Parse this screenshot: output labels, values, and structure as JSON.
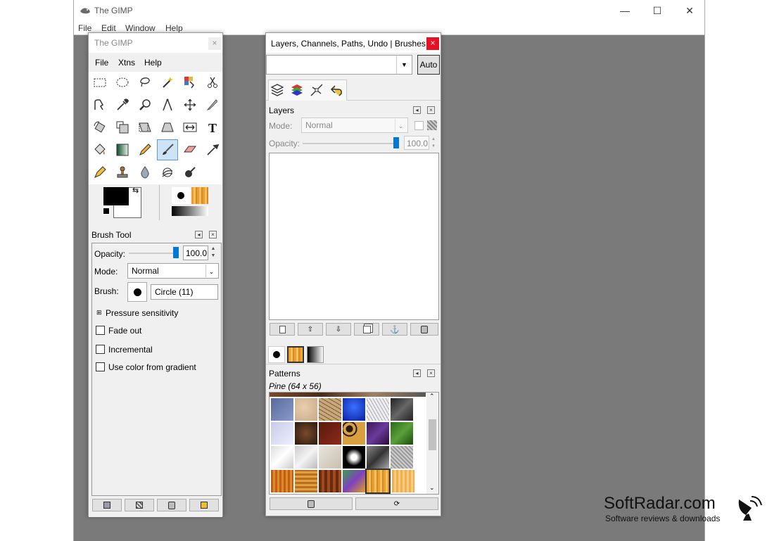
{
  "main_window": {
    "title": "The GIMP",
    "menu": [
      "File",
      "Edit",
      "Window",
      "Help"
    ],
    "minimize": "—",
    "maximize": "☐",
    "close": "✕"
  },
  "toolbox": {
    "title": "The GIMP",
    "close": "×",
    "menu": [
      "File",
      "Xtns",
      "Help"
    ],
    "tool_options": {
      "title": "Brush Tool",
      "opacity_label": "Opacity:",
      "opacity_value": "100.0",
      "opacity_fraction": 1.0,
      "mode_label": "Mode:",
      "mode_value": "Normal",
      "brush_label": "Brush:",
      "brush_value": "Circle (11)",
      "pressure_label": "Pressure sensitivity",
      "fade_out_label": "Fade out",
      "incremental_label": "Incremental",
      "use_color_label": "Use color from gradient"
    }
  },
  "layers_dock": {
    "title": "Layers, Channels, Paths, Undo | Brushes,...",
    "close": "×",
    "auto_label": "Auto",
    "layers": {
      "title": "Layers",
      "mode_label": "Mode:",
      "mode_value": "Normal",
      "opacity_label": "Opacity:",
      "opacity_value": "100.0",
      "opacity_fraction": 1.0
    },
    "patterns": {
      "title": "Patterns",
      "selected_label": "Pine (64 x 56)"
    }
  },
  "watermark": {
    "brand": "SoftRadar.com",
    "tagline": "Software reviews & downloads"
  },
  "colors": {
    "canvas": "#7a7a7a",
    "accent": "#0078d7"
  }
}
